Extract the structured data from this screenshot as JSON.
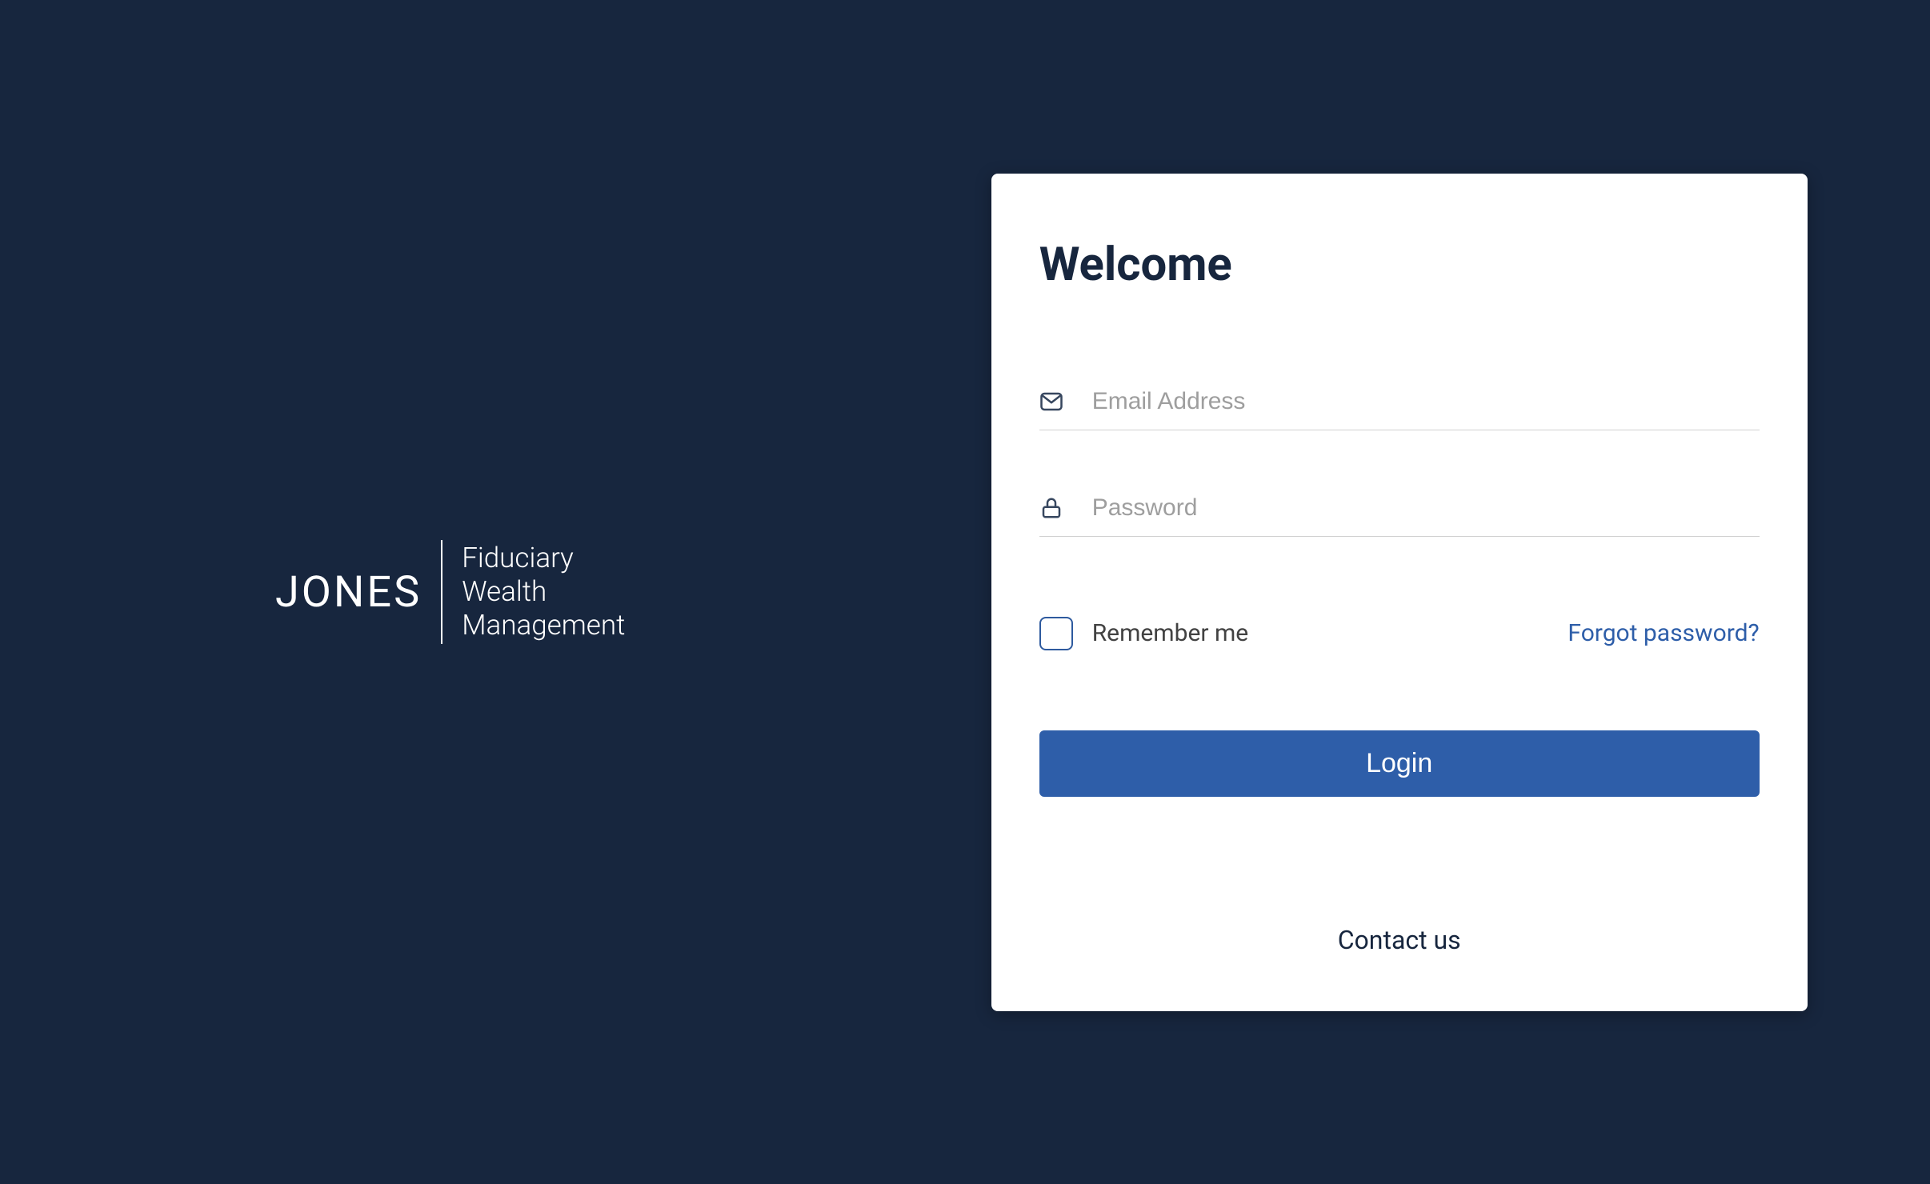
{
  "logo": {
    "brand": "JONES",
    "tagline_line1": "Fiduciary",
    "tagline_line2": "Wealth",
    "tagline_line3": "Management"
  },
  "card": {
    "title": "Welcome",
    "email": {
      "placeholder": "Email Address",
      "value": ""
    },
    "password": {
      "placeholder": "Password",
      "value": ""
    },
    "remember_label": "Remember me",
    "forgot_label": "Forgot password?",
    "login_label": "Login",
    "contact_label": "Contact us"
  }
}
